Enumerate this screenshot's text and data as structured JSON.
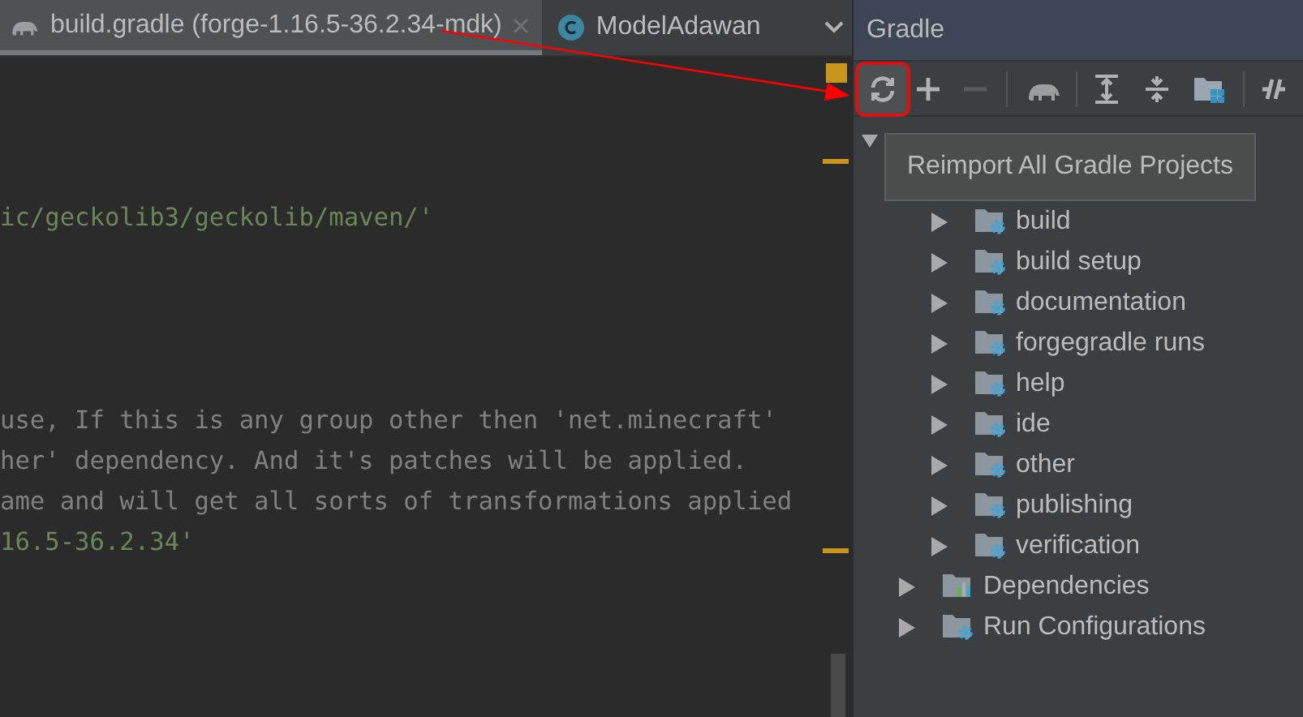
{
  "editor_tabs": [
    {
      "label": "build.gradle (forge-1.16.5-36.2.34-mdk)",
      "kind": "gradle",
      "selected": true
    },
    {
      "label": "ModelAdawan",
      "kind": "class",
      "selected": false
    }
  ],
  "code_lines": [
    {
      "text": "ic/geckolib3/geckolib/maven/'",
      "kind": "string"
    },
    {
      "text": "use, If this is any group other then 'net.minecraft'",
      "kind": "comment"
    },
    {
      "text": "her' dependency. And it's patches will be applied.",
      "kind": "comment"
    },
    {
      "text": "ame and will get all sorts of transformations applied",
      "kind": "comment"
    },
    {
      "text": "16.5-36.2.34'",
      "kind": "string"
    }
  ],
  "gradle_panel": {
    "title": "Gradle",
    "tooltip": "Reimport All Gradle Projects",
    "tree": [
      {
        "expanded": true,
        "children": [
          {
            "label": "build",
            "kind": "tasks",
            "expanded": false
          },
          {
            "label": "build setup",
            "kind": "tasks",
            "expanded": false
          },
          {
            "label": "documentation",
            "kind": "tasks",
            "expanded": false
          },
          {
            "label": "forgegradle runs",
            "kind": "tasks",
            "expanded": false
          },
          {
            "label": "help",
            "kind": "tasks",
            "expanded": false
          },
          {
            "label": "ide",
            "kind": "tasks",
            "expanded": false
          },
          {
            "label": "other",
            "kind": "tasks",
            "expanded": false
          },
          {
            "label": "publishing",
            "kind": "tasks",
            "expanded": false
          },
          {
            "label": "verification",
            "kind": "tasks",
            "expanded": false
          },
          {
            "label": "Dependencies",
            "kind": "dependencies",
            "expanded": false
          },
          {
            "label": "Run Configurations",
            "kind": "runs",
            "expanded": false
          }
        ]
      }
    ]
  }
}
